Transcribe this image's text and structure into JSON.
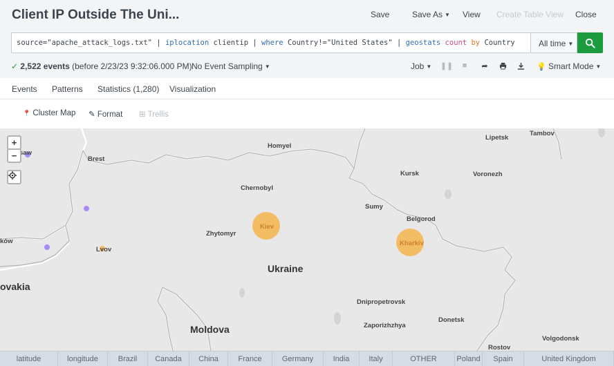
{
  "header": {
    "title": "Client IP Outside The Uni...",
    "save": "Save",
    "save_as": "Save As",
    "view": "View",
    "create_table_view": "Create Table View",
    "close": "Close"
  },
  "search": {
    "query_parts": [
      {
        "t": "source=\"apache_attack_logs.txt\"  | ",
        "c": ""
      },
      {
        "t": "iplocation",
        "c": "kw"
      },
      {
        "t": " clientip | ",
        "c": ""
      },
      {
        "t": "where",
        "c": "kw"
      },
      {
        "t": " Country!=\"United States\" | ",
        "c": ""
      },
      {
        "t": "geostats",
        "c": "kw"
      },
      {
        "t": " ",
        "c": ""
      },
      {
        "t": "count",
        "c": "fn"
      },
      {
        "t": " ",
        "c": ""
      },
      {
        "t": "by",
        "c": "arg"
      },
      {
        "t": " Country",
        "c": ""
      }
    ],
    "time_range": "All time"
  },
  "status": {
    "events": "2,522 events",
    "before": "(before 2/23/23 9:32:06.000 PM)",
    "sampling": "No Event Sampling",
    "job": "Job",
    "mode": "Smart Mode"
  },
  "tabs": [
    "Events",
    "Patterns",
    "Statistics (1,280)",
    "Visualization"
  ],
  "active_tab": "Visualization",
  "viz": {
    "type_label": "Cluster Map",
    "format_label": "Format",
    "trellis_label": "Trellis"
  },
  "map": {
    "places": [
      {
        "name": "Homyel",
        "cls": "city"
      },
      {
        "name": "Lipetsk",
        "cls": "city"
      },
      {
        "name": "Tambov",
        "cls": "city"
      },
      {
        "name": "Brest",
        "cls": "city"
      },
      {
        "name": "Kursk",
        "cls": "city"
      },
      {
        "name": "Voronezh",
        "cls": "city"
      },
      {
        "name": "Chernobyl",
        "cls": "city"
      },
      {
        "name": "Sumy",
        "cls": "city"
      },
      {
        "name": "Belgorod",
        "cls": "city"
      },
      {
        "name": "Zhytomyr",
        "cls": "city"
      },
      {
        "name": "Kiev",
        "cls": "city"
      },
      {
        "name": "Kharkiv",
        "cls": "city"
      },
      {
        "name": "Lvov",
        "cls": "city"
      },
      {
        "name": "Ukraine",
        "cls": "country"
      },
      {
        "name": "Dnipropetrovsk",
        "cls": "city"
      },
      {
        "name": "Zaporizhzhya",
        "cls": "city"
      },
      {
        "name": "Donetsk",
        "cls": "city"
      },
      {
        "name": "Moldova",
        "cls": "country"
      },
      {
        "name": "Volgodonsk",
        "cls": "city"
      },
      {
        "name": "Rostov",
        "cls": "city"
      },
      {
        "name": "ovakia",
        "cls": "country"
      },
      {
        "name": "ków",
        "cls": "city"
      },
      {
        "name": "saw",
        "cls": "city"
      }
    ],
    "colors": {
      "cluster": "#f5b041",
      "purple": "#a78bfa",
      "land": "#e8e8e8"
    }
  },
  "legend_columns": [
    "latitude",
    "longitude",
    "Brazil",
    "Canada",
    "China",
    "France",
    "Germany",
    "India",
    "Italy",
    "OTHER",
    "Poland",
    "Spain",
    "United Kingdom"
  ]
}
